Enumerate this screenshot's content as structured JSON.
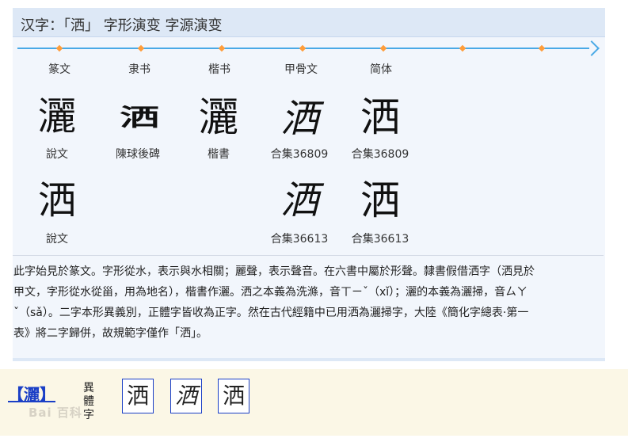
{
  "header": {
    "title": "汉字：「洒」 字形演变 字源演变"
  },
  "timeline": {
    "stages": [
      "篆文",
      "隶书",
      "楷书",
      "甲骨文",
      "简体"
    ]
  },
  "row1": [
    {
      "glyph": "灑",
      "caption": "說文"
    },
    {
      "glyph": "洒",
      "caption": "陳球後碑"
    },
    {
      "glyph": "灑",
      "caption": "楷書"
    },
    {
      "glyph": "洒",
      "caption": "合集36809"
    },
    {
      "glyph": "洒",
      "caption": "合集36809"
    }
  ],
  "row2": [
    {
      "glyph": "洒",
      "caption": "說文"
    },
    {
      "glyph": "洒",
      "caption": "合集36613"
    },
    {
      "glyph": "洒",
      "caption": "合集36613"
    }
  ],
  "description": {
    "line1": "此字始見於篆文。字形從水，表示與水相關；麗聲，表示聲音。在六書中屬於形聲。隸書假借洒字（洒見於",
    "line2": "甲文，字形從水從甾，用為地名），楷書作灑。洒之本義為洗滌，音ㄒㄧˇ（xǐ）；灑的本義為灑掃，音ㄙㄚ",
    "line3": "ˇ（sǎ）。二字本形異義別，正體字皆收為正字。然在古代經籍中已用洒為灑掃字，大陸《簡化字總表·第一",
    "line4": "表》將二字歸併，故規範字僅作「洒」。"
  },
  "variants": {
    "headword": "【灑】",
    "label_lines": [
      "異",
      "體",
      "字"
    ],
    "watermark": "Bai 百科",
    "chars": [
      "洒",
      "洒",
      "洒"
    ]
  }
}
